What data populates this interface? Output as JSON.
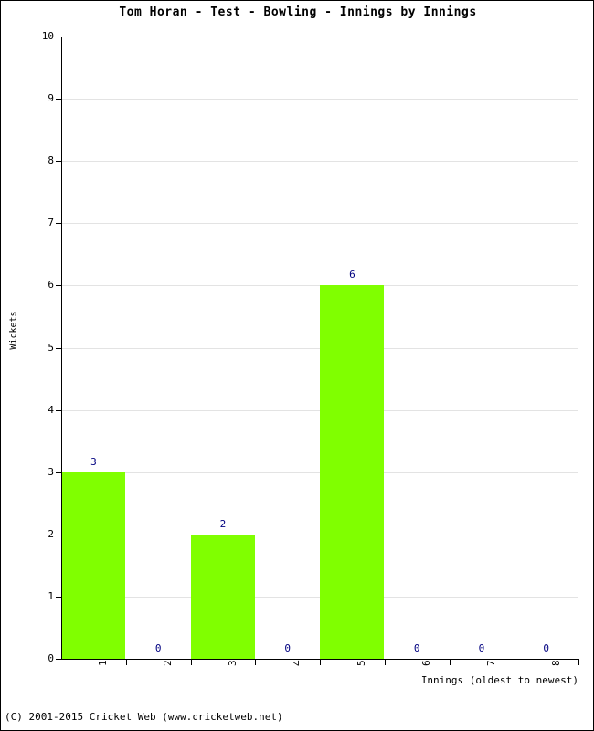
{
  "footer": {
    "copyright": "(C) 2001-2015 Cricket Web (www.cricketweb.net)"
  },
  "chart_data": {
    "type": "bar",
    "title": "Tom Horan - Test - Bowling - Innings by Innings",
    "xlabel": "Innings (oldest to newest)",
    "ylabel": "Wickets",
    "categories": [
      "1",
      "2",
      "3",
      "4",
      "5",
      "6",
      "7",
      "8"
    ],
    "values": [
      3,
      0,
      2,
      0,
      6,
      0,
      0,
      0
    ],
    "value_labels": [
      "3",
      "0",
      "2",
      "0",
      "6",
      "0",
      "0",
      "0"
    ],
    "ylim": [
      0,
      10
    ],
    "ytick_labels": [
      "0",
      "1",
      "2",
      "3",
      "4",
      "5",
      "6",
      "7",
      "8",
      "9",
      "10"
    ],
    "ytick_values": [
      0,
      1,
      2,
      3,
      4,
      5,
      6,
      7,
      8,
      9,
      10
    ],
    "grid": true,
    "legend": false,
    "bar_color": "#80ff00",
    "value_label_color": "#000080",
    "grid_color": "#e3e3e3",
    "axis_color": "#000000"
  }
}
